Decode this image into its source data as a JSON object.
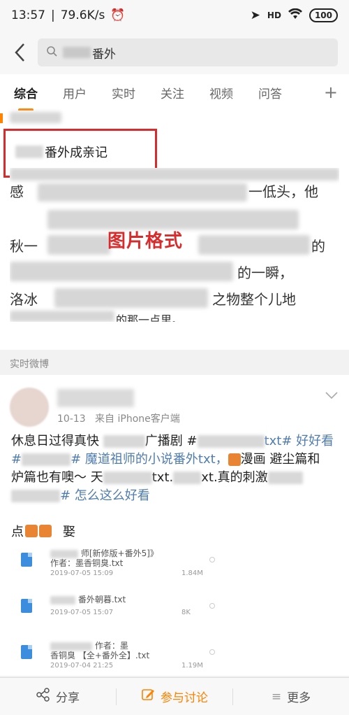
{
  "status_bar": {
    "time": "13:57",
    "network_speed": "79.6K/s",
    "battery": "100",
    "signal_label": "HD"
  },
  "search": {
    "query_suffix": "番外"
  },
  "tabs": [
    {
      "label": "综合"
    },
    {
      "label": "用户"
    },
    {
      "label": "实时"
    },
    {
      "label": "关注"
    },
    {
      "label": "视频"
    },
    {
      "label": "问答"
    }
  ],
  "article": {
    "title_suffix": "番外成亲记",
    "image_label": "图片格式",
    "image_text_fragments": [
      "感",
      "一低头，他",
      "秋一",
      "的",
      "的一瞬，",
      "洛冰",
      "之物整个儿地",
      "的那一点里。"
    ]
  },
  "realtime_section": {
    "label": "实时微博"
  },
  "post": {
    "date": "10-13",
    "source": "来自 iPhone客户端",
    "text_part1": "休息日过得真快 ",
    "text_part2": "广播剧 #",
    "text_part3": "txt# 好好看",
    "text_part4": "# 魔道祖师的小说番外txt，",
    "text_part5": "漫画 避尘篇和",
    "text_part6": "炉篇也有噢～ 天",
    "text_part7": "txt.",
    "text_part8": "xt.真的刺激",
    "text_part9": "# 怎么这么好看",
    "attach_prefix": "点",
    "attach_suffix": "娶",
    "files": [
      {
        "name": "师[新修版+番外5]》",
        "sub": "作者：墨香铜臭.txt",
        "date": "2019-07-05 15:09",
        "size": "1.84M"
      },
      {
        "name": "番外朝暮.txt",
        "sub": "",
        "date": "2019-07-05 15:07",
        "size": "8K"
      },
      {
        "name": "作者：墨",
        "sub": "香铜臭 【全+番外全】.txt",
        "date": "2019-07-04 21:25",
        "size": "1.19M"
      }
    ]
  },
  "bottom_bar": {
    "share": "分享",
    "discuss": "参与讨论",
    "more": "更多"
  },
  "colors": {
    "accent": "#ff8200",
    "highlight": "#d92b2b",
    "link": "#507daf"
  }
}
